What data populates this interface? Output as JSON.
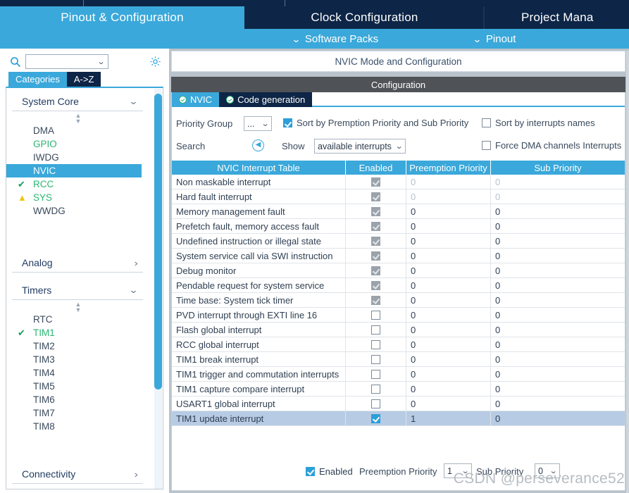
{
  "nav": {
    "tabs": [
      {
        "label": "Pinout & Configuration",
        "active": true
      },
      {
        "label": "Clock Configuration",
        "active": false
      },
      {
        "label": "Project Mana",
        "active": false
      }
    ]
  },
  "subbar": {
    "software_packs": "Software Packs",
    "pinout": "Pinout",
    "chevron": "⌄"
  },
  "sidebar": {
    "search": {
      "value": "",
      "placeholder": ""
    },
    "icons": {
      "search": "search-icon",
      "gear": "gear-icon"
    },
    "view_tabs": [
      {
        "label": "Categories",
        "active": true
      },
      {
        "label": "A->Z",
        "active": false
      }
    ],
    "sections": [
      {
        "title": "System Core",
        "expanded": true,
        "items": [
          {
            "label": "DMA",
            "state": "normal",
            "mark": ""
          },
          {
            "label": "GPIO",
            "state": "configured",
            "mark": ""
          },
          {
            "label": "IWDG",
            "state": "normal",
            "mark": ""
          },
          {
            "label": "NVIC",
            "state": "selected",
            "mark": ""
          },
          {
            "label": "RCC",
            "state": "configured",
            "mark": "check"
          },
          {
            "label": "SYS",
            "state": "configured",
            "mark": "warn"
          },
          {
            "label": "WWDG",
            "state": "normal",
            "mark": ""
          }
        ]
      },
      {
        "title": "Analog",
        "expanded": false,
        "items": []
      },
      {
        "title": "Timers",
        "expanded": true,
        "items": [
          {
            "label": "RTC",
            "state": "normal",
            "mark": ""
          },
          {
            "label": "TIM1",
            "state": "configured",
            "mark": "check"
          },
          {
            "label": "TIM2",
            "state": "normal",
            "mark": ""
          },
          {
            "label": "TIM3",
            "state": "normal",
            "mark": ""
          },
          {
            "label": "TIM4",
            "state": "normal",
            "mark": ""
          },
          {
            "label": "TIM5",
            "state": "normal",
            "mark": ""
          },
          {
            "label": "TIM6",
            "state": "normal",
            "mark": ""
          },
          {
            "label": "TIM7",
            "state": "normal",
            "mark": ""
          },
          {
            "label": "TIM8",
            "state": "normal",
            "mark": ""
          }
        ]
      },
      {
        "title": "Connectivity",
        "expanded": false,
        "items": []
      }
    ]
  },
  "panel": {
    "mode_header": "NVIC Mode and Configuration",
    "config_header": "Configuration",
    "tabs": [
      {
        "label": "NVIC",
        "active": true,
        "status": "ok"
      },
      {
        "label": "Code generation",
        "active": false,
        "status": "ok"
      }
    ],
    "controls": {
      "priority_group_label": "Priority Group",
      "priority_group_value": "...",
      "sort_by_premption_label": "Sort by Premption Priority and Sub Priority",
      "sort_by_premption_checked": true,
      "sort_by_names_label": "Sort by interrupts names",
      "sort_by_names_checked": false,
      "search_label": "Search",
      "search_back_icon": "chevron-left-circle-icon",
      "show_label": "Show",
      "show_value": "available interrupts",
      "force_dma_label": "Force DMA channels Interrupts",
      "force_dma_checked": false
    },
    "table": {
      "columns": [
        "NVIC Interrupt Table",
        "Enabled",
        "Preemption Priority",
        "Sub Priority"
      ],
      "rows": [
        {
          "name": "Non maskable interrupt",
          "enabled": true,
          "locked": true,
          "preemption": "0",
          "sub": "0",
          "dim": true,
          "selected": false
        },
        {
          "name": "Hard fault interrupt",
          "enabled": true,
          "locked": true,
          "preemption": "0",
          "sub": "0",
          "dim": true,
          "selected": false
        },
        {
          "name": "Memory management fault",
          "enabled": true,
          "locked": true,
          "preemption": "0",
          "sub": "0",
          "dim": false,
          "selected": false
        },
        {
          "name": "Prefetch fault, memory access fault",
          "enabled": true,
          "locked": true,
          "preemption": "0",
          "sub": "0",
          "dim": false,
          "selected": false
        },
        {
          "name": "Undefined instruction or illegal state",
          "enabled": true,
          "locked": true,
          "preemption": "0",
          "sub": "0",
          "dim": false,
          "selected": false
        },
        {
          "name": "System service call via SWI instruction",
          "enabled": true,
          "locked": true,
          "preemption": "0",
          "sub": "0",
          "dim": false,
          "selected": false
        },
        {
          "name": "Debug monitor",
          "enabled": true,
          "locked": true,
          "preemption": "0",
          "sub": "0",
          "dim": false,
          "selected": false
        },
        {
          "name": "Pendable request for system service",
          "enabled": true,
          "locked": true,
          "preemption": "0",
          "sub": "0",
          "dim": false,
          "selected": false
        },
        {
          "name": "Time base: System tick timer",
          "enabled": true,
          "locked": true,
          "preemption": "0",
          "sub": "0",
          "dim": false,
          "selected": false
        },
        {
          "name": "PVD interrupt through EXTI line 16",
          "enabled": false,
          "locked": false,
          "preemption": "0",
          "sub": "0",
          "dim": false,
          "selected": false
        },
        {
          "name": "Flash global interrupt",
          "enabled": false,
          "locked": false,
          "preemption": "0",
          "sub": "0",
          "dim": false,
          "selected": false
        },
        {
          "name": "RCC global interrupt",
          "enabled": false,
          "locked": false,
          "preemption": "0",
          "sub": "0",
          "dim": false,
          "selected": false
        },
        {
          "name": "TIM1 break interrupt",
          "enabled": false,
          "locked": false,
          "preemption": "0",
          "sub": "0",
          "dim": false,
          "selected": false
        },
        {
          "name": "TIM1 trigger and commutation interrupts",
          "enabled": false,
          "locked": false,
          "preemption": "0",
          "sub": "0",
          "dim": false,
          "selected": false
        },
        {
          "name": "TIM1 capture compare interrupt",
          "enabled": false,
          "locked": false,
          "preemption": "0",
          "sub": "0",
          "dim": false,
          "selected": false
        },
        {
          "name": "USART1 global interrupt",
          "enabled": false,
          "locked": false,
          "preemption": "0",
          "sub": "0",
          "dim": false,
          "selected": false
        },
        {
          "name": "TIM1 update interrupt",
          "enabled": true,
          "locked": false,
          "preemption": "1",
          "sub": "0",
          "dim": false,
          "selected": true
        }
      ]
    },
    "footer": {
      "enabled_label": "Enabled",
      "enabled_checked": true,
      "preemption_label": "Preemption Priority",
      "preemption_value": "1",
      "sub_label": "Sub Priority",
      "sub_value": "0"
    }
  },
  "watermark": "CSDN @perseverance52",
  "colors": {
    "accent_blue": "#3aa8da",
    "dark_navy": "#0d2546",
    "selected_row": "#b7cbe4",
    "green": "#2cb673",
    "warn_yellow": "#f0c419"
  }
}
